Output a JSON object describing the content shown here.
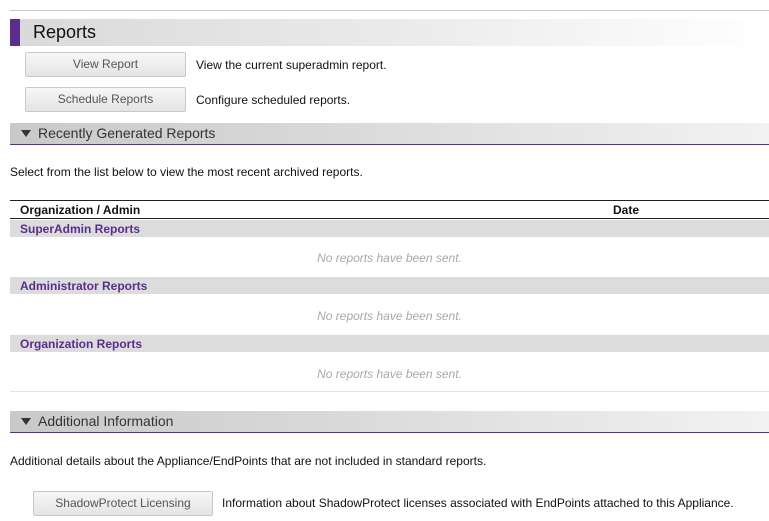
{
  "header": {
    "title": "Reports"
  },
  "actions": [
    {
      "label": "View Report",
      "description": "View the current superadmin report."
    },
    {
      "label": "Schedule Reports",
      "description": "Configure scheduled reports."
    }
  ],
  "recent": {
    "title": "Recently Generated Reports",
    "intro": "Select from the list below to view the most recent archived reports.",
    "columns": [
      "Organization / Admin",
      "Date"
    ],
    "groups": [
      {
        "label": "SuperAdmin Reports",
        "empty": "No reports have been sent."
      },
      {
        "label": "Administrator Reports",
        "empty": "No reports have been sent."
      },
      {
        "label": "Organization Reports",
        "empty": "No reports have been sent."
      }
    ]
  },
  "additional": {
    "title": "Additional Information",
    "intro": "Additional details about the Appliance/EndPoints that are not included in standard reports.",
    "button": "ShadowProtect Licensing",
    "button_description": "Information about ShadowProtect licenses associated with EndPoints attached to this Appliance."
  },
  "colors": {
    "accent": "#5b2d8c",
    "group_bg": "#dcdcdc",
    "empty_text": "#a8a8a8"
  },
  "icons": {
    "collapse": "triangle-down-icon"
  }
}
